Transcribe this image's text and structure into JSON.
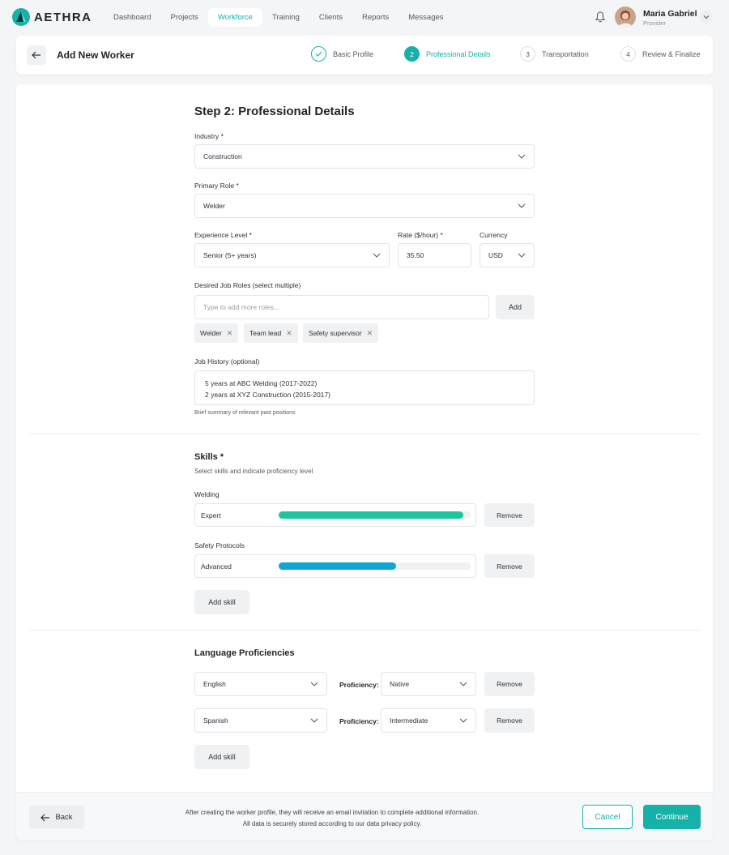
{
  "brand": {
    "name": "AETHRA",
    "accent": "#16b1a8"
  },
  "nav": {
    "items": [
      {
        "label": "Dashboard"
      },
      {
        "label": "Projects"
      },
      {
        "label": "Workforce",
        "active": true
      },
      {
        "label": "Training"
      },
      {
        "label": "Clients"
      },
      {
        "label": "Reports"
      },
      {
        "label": "Messages"
      }
    ]
  },
  "user": {
    "name": "Maria Gabriel",
    "role": "Provider"
  },
  "header": {
    "title": "Add New Worker",
    "steps": [
      {
        "num": "",
        "label": "Basic Profile",
        "state": "done"
      },
      {
        "num": "2",
        "label": "Professional Details",
        "state": "current"
      },
      {
        "num": "3",
        "label": "Transportation",
        "state": "upcoming"
      },
      {
        "num": "4",
        "label": "Review & Finalize",
        "state": "upcoming"
      }
    ]
  },
  "form": {
    "title": "Step 2: Professional Details",
    "industry": {
      "label": "Industry *",
      "value": "Construction"
    },
    "primary_role": {
      "label": "Primary Role *",
      "value": "Welder"
    },
    "experience": {
      "label": "Experience Level *",
      "value": "Senior (5+ years)"
    },
    "rate": {
      "label": "Rate ($/hour) *",
      "value": "35.50"
    },
    "currency": {
      "label": "Currency",
      "value": "USD"
    },
    "desired_roles": {
      "label": "Desired Job Roles (select multiple)",
      "placeholder": "Type to add more roles...",
      "add_label": "Add",
      "tags": [
        "Welder",
        "Team lead",
        "Safety supervisor"
      ]
    },
    "job_history": {
      "label": "Job History (optional)",
      "lines": [
        "5 years at ABC Welding (2017-2022)",
        "2 years at XYZ Construction (2015-2017)"
      ],
      "hint": "Brief summary of relevant past positions"
    }
  },
  "skills": {
    "title": "Skills *",
    "subtitle": "Select skills and indicate proficiency level",
    "items": [
      {
        "name": "Welding",
        "level": "Expert",
        "proficiency": 0.96,
        "color": "#1dc4a0",
        "remove_label": "Remove"
      },
      {
        "name": "Safety Protocols",
        "level": "Advanced",
        "proficiency": 0.61,
        "color": "#10a6d4",
        "remove_label": "Remove"
      }
    ],
    "add_label": "Add skill"
  },
  "languages": {
    "title": "Language Proficiencies",
    "proficiency_label": "Proficiency:",
    "items": [
      {
        "language": "English",
        "proficiency": "Native",
        "remove_label": "Remove"
      },
      {
        "language": "Spanish",
        "proficiency": "Intermediate",
        "remove_label": "Remove"
      }
    ],
    "add_label": "Add skill"
  },
  "footer": {
    "back_label": "Back",
    "note_line1": "After creating the worker profile, they will receive an email invitation to complete additional information.",
    "note_line2": "All data is securely stored according to our data privacy policy.",
    "cancel_label": "Cancel",
    "continue_label": "Continue"
  }
}
